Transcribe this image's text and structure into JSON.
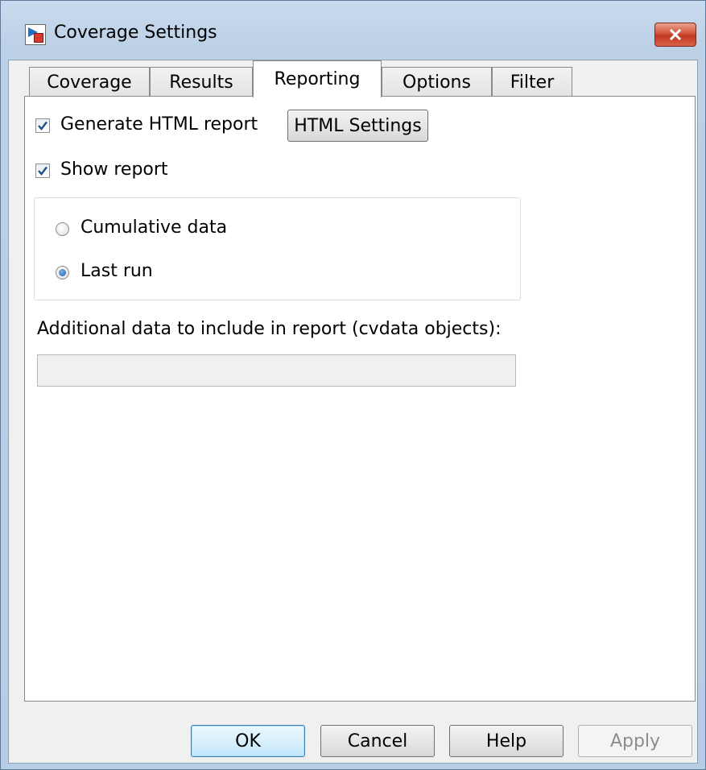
{
  "window": {
    "title": "Coverage Settings"
  },
  "tabs": [
    {
      "label": "Coverage",
      "active": false
    },
    {
      "label": "Results",
      "active": false
    },
    {
      "label": "Reporting",
      "active": true
    },
    {
      "label": "Options",
      "active": false
    },
    {
      "label": "Filter",
      "active": false
    }
  ],
  "reporting": {
    "generate_html_report": {
      "label": "Generate HTML report",
      "checked": true
    },
    "html_settings_button": "HTML Settings",
    "show_report": {
      "label": "Show report",
      "checked": true
    },
    "data_mode": {
      "options": [
        {
          "label": "Cumulative data",
          "selected": false
        },
        {
          "label": "Last run",
          "selected": true
        }
      ]
    },
    "additional_data": {
      "label": "Additional data to include in report (cvdata objects):",
      "value": ""
    }
  },
  "buttons": {
    "ok": "OK",
    "cancel": "Cancel",
    "help": "Help",
    "apply": "Apply"
  },
  "colors": {
    "frame": "#b7cde5",
    "close_button": "#c2381f",
    "radio_selected": "#1a5fae",
    "checkmark": "#1f4e8c"
  }
}
